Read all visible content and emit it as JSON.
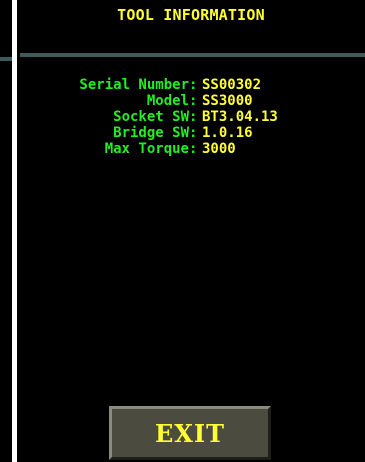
{
  "header": {
    "title": "TOOL INFORMATION"
  },
  "tool_info": {
    "rows": [
      {
        "label": "Serial Number",
        "value": "SS00302"
      },
      {
        "label": "Model",
        "value": "SS3000"
      },
      {
        "label": "Socket SW",
        "value": "BT3.04.13"
      },
      {
        "label": "Bridge SW",
        "value": "1.0.16"
      },
      {
        "label": "Max Torque",
        "value": "3000"
      }
    ],
    "separator": ":"
  },
  "footer": {
    "exit_label": "EXIT"
  },
  "colors": {
    "label": "#22ee22",
    "value": "#ffff33",
    "title": "#ffff33",
    "background": "#000000",
    "rule": "#3f5a5a",
    "button": "#4b4b40"
  }
}
